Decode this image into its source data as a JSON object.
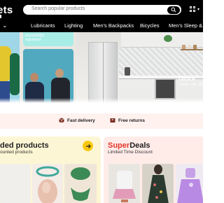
{
  "header": {
    "logo_text": "ets",
    "search_placeholder": "Search popular products",
    "nav_items": [
      "Lubricants",
      "Lighting",
      "Men's Backpacks",
      "Bicycles",
      "Men's Sleep & L"
    ]
  },
  "hero": {
    "promo_text_line1": "successfully",
    "promo_text_line2": "registered",
    "watermark_brand": "iStock",
    "watermark_credit": "Credit: LSA_36"
  },
  "benefits": {
    "items": [
      {
        "label": "Fast delivery",
        "icon": "box-icon"
      },
      {
        "label": "Free returns",
        "icon": "return-icon"
      }
    ]
  },
  "cards": {
    "recommended": {
      "title": "ded products",
      "subtitle": "ounted products"
    },
    "superdeals": {
      "title_part1": "Super",
      "title_part2": "Deals",
      "subtitle": "Limited Time Discount"
    }
  },
  "colors": {
    "header_bg": "#000000",
    "accent_yellow": "#f9c80f",
    "deal_red": "#e4342a",
    "benefits_bg": "#fff1ee",
    "card_left_bg": "#fdf6d4",
    "card_right_bg": "#ffece9"
  }
}
